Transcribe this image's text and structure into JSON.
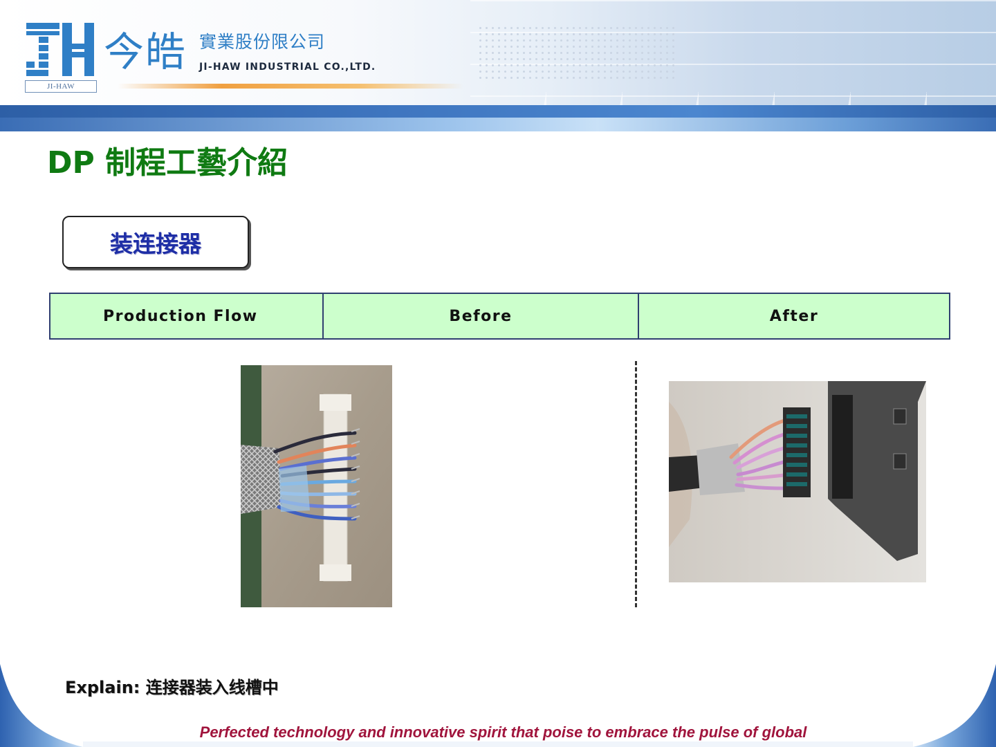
{
  "header": {
    "logo_mark_text": "JH",
    "logo_sub": "JI-HAW",
    "logo_cn": "今皓",
    "company_cn": "實業股份限公司",
    "company_en": "JI-HAW INDUSTRIAL CO.,LTD."
  },
  "page": {
    "title": "DP 制程工藝介紹",
    "step_label": "装连接器"
  },
  "table": {
    "columns": [
      "Production Flow",
      "Before",
      "After"
    ]
  },
  "images": {
    "before": "cable-wires-before-connector-photo",
    "after": "cable-wires-after-connector-photo"
  },
  "explain": "Explain:  连接器装入线槽中",
  "footer": {
    "tagline": "Perfected technology and innovative spirit that poise to embrace the pulse of global"
  },
  "colors": {
    "title_green": "#0f7a12",
    "step_text_blue": "#1e2ea6",
    "table_bg": "#ccffcc",
    "footer_text": "#a0143c",
    "brand_blue": "#2f7fc6"
  }
}
